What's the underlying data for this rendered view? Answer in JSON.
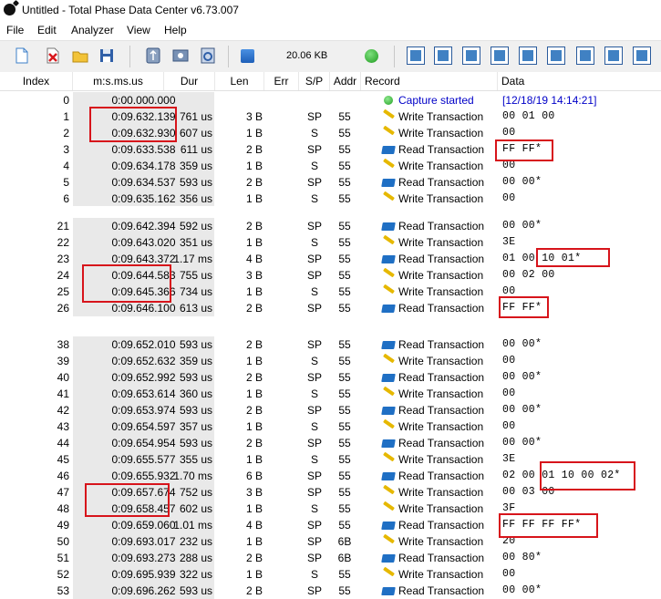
{
  "window": {
    "title": "Untitled - Total Phase Data Center v6.73.007"
  },
  "menu": [
    "File",
    "Edit",
    "Analyzer",
    "View",
    "Help"
  ],
  "toolbar": {
    "file_size": "20.06 KB"
  },
  "columns": [
    "Index",
    "m:s.ms.us",
    "Dur",
    "Len",
    "Err",
    "S/P",
    "Addr",
    "Record",
    "Data"
  ],
  "rows": [
    {
      "index": "0",
      "time": "0:00.000.000",
      "dur": "",
      "len": "",
      "sp": "",
      "addr": "",
      "record": "Capture started",
      "type": "start",
      "data": "[12/18/19 14:14:21]"
    },
    {
      "index": "1",
      "time": "0:09.632.139",
      "dur": "761 us",
      "len": "3 B",
      "sp": "SP",
      "addr": "55",
      "record": "Write Transaction",
      "type": "write",
      "data": "00 01 00"
    },
    {
      "index": "2",
      "time": "0:09.632.930",
      "dur": "607 us",
      "len": "1 B",
      "sp": "S",
      "addr": "55",
      "record": "Write Transaction",
      "type": "write",
      "data": "00"
    },
    {
      "index": "3",
      "time": "0:09.633.538",
      "dur": "611 us",
      "len": "2 B",
      "sp": "SP",
      "addr": "55",
      "record": "Read Transaction",
      "type": "read",
      "data": "FF FF*"
    },
    {
      "index": "4",
      "time": "0:09.634.178",
      "dur": "359 us",
      "len": "1 B",
      "sp": "S",
      "addr": "55",
      "record": "Write Transaction",
      "type": "write",
      "data": "00"
    },
    {
      "index": "5",
      "time": "0:09.634.537",
      "dur": "593 us",
      "len": "2 B",
      "sp": "SP",
      "addr": "55",
      "record": "Read Transaction",
      "type": "read",
      "data": "00 00*"
    },
    {
      "index": "6",
      "time": "0:09.635.162",
      "dur": "356 us",
      "len": "1 B",
      "sp": "S",
      "addr": "55",
      "record": "Write Transaction",
      "type": "write",
      "data": "00"
    },
    {
      "index": "21",
      "time": "0:09.642.394",
      "dur": "592 us",
      "len": "2 B",
      "sp": "SP",
      "addr": "55",
      "record": "Read Transaction",
      "type": "read",
      "data": "00 00*"
    },
    {
      "index": "22",
      "time": "0:09.643.020",
      "dur": "351 us",
      "len": "1 B",
      "sp": "S",
      "addr": "55",
      "record": "Write Transaction",
      "type": "write",
      "data": "3E"
    },
    {
      "index": "23",
      "time": "0:09.643.372",
      "dur": "1.17 ms",
      "len": "4 B",
      "sp": "SP",
      "addr": "55",
      "record": "Read Transaction",
      "type": "read",
      "data": "01 00 10 01*"
    },
    {
      "index": "24",
      "time": "0:09.644.583",
      "dur": "755 us",
      "len": "3 B",
      "sp": "SP",
      "addr": "55",
      "record": "Write Transaction",
      "type": "write",
      "data": "00 02 00"
    },
    {
      "index": "25",
      "time": "0:09.645.366",
      "dur": "734 us",
      "len": "1 B",
      "sp": "S",
      "addr": "55",
      "record": "Write Transaction",
      "type": "write",
      "data": "00"
    },
    {
      "index": "26",
      "time": "0:09.646.100",
      "dur": "613 us",
      "len": "2 B",
      "sp": "SP",
      "addr": "55",
      "record": "Read Transaction",
      "type": "read",
      "data": "FF FF*"
    },
    {
      "index": "38",
      "time": "0:09.652.010",
      "dur": "593 us",
      "len": "2 B",
      "sp": "SP",
      "addr": "55",
      "record": "Read Transaction",
      "type": "read",
      "data": "00 00*"
    },
    {
      "index": "39",
      "time": "0:09.652.632",
      "dur": "359 us",
      "len": "1 B",
      "sp": "S",
      "addr": "55",
      "record": "Write Transaction",
      "type": "write",
      "data": "00"
    },
    {
      "index": "40",
      "time": "0:09.652.992",
      "dur": "593 us",
      "len": "2 B",
      "sp": "SP",
      "addr": "55",
      "record": "Read Transaction",
      "type": "read",
      "data": "00 00*"
    },
    {
      "index": "41",
      "time": "0:09.653.614",
      "dur": "360 us",
      "len": "1 B",
      "sp": "S",
      "addr": "55",
      "record": "Write Transaction",
      "type": "write",
      "data": "00"
    },
    {
      "index": "42",
      "time": "0:09.653.974",
      "dur": "593 us",
      "len": "2 B",
      "sp": "SP",
      "addr": "55",
      "record": "Read Transaction",
      "type": "read",
      "data": "00 00*"
    },
    {
      "index": "43",
      "time": "0:09.654.597",
      "dur": "357 us",
      "len": "1 B",
      "sp": "S",
      "addr": "55",
      "record": "Write Transaction",
      "type": "write",
      "data": "00"
    },
    {
      "index": "44",
      "time": "0:09.654.954",
      "dur": "593 us",
      "len": "2 B",
      "sp": "SP",
      "addr": "55",
      "record": "Read Transaction",
      "type": "read",
      "data": "00 00*"
    },
    {
      "index": "45",
      "time": "0:09.655.577",
      "dur": "355 us",
      "len": "1 B",
      "sp": "S",
      "addr": "55",
      "record": "Write Transaction",
      "type": "write",
      "data": "3E"
    },
    {
      "index": "46",
      "time": "0:09.655.932",
      "dur": "1.70 ms",
      "len": "6 B",
      "sp": "SP",
      "addr": "55",
      "record": "Read Transaction",
      "type": "read",
      "data": "02 00 01 10 00 02*"
    },
    {
      "index": "47",
      "time": "0:09.657.674",
      "dur": "752 us",
      "len": "3 B",
      "sp": "SP",
      "addr": "55",
      "record": "Write Transaction",
      "type": "write",
      "data": "00 03 00"
    },
    {
      "index": "48",
      "time": "0:09.658.457",
      "dur": "602 us",
      "len": "1 B",
      "sp": "S",
      "addr": "55",
      "record": "Write Transaction",
      "type": "write",
      "data": "3F"
    },
    {
      "index": "49",
      "time": "0:09.659.060",
      "dur": "1.01 ms",
      "len": "4 B",
      "sp": "SP",
      "addr": "55",
      "record": "Read Transaction",
      "type": "read",
      "data": "FF FF FF FF*"
    },
    {
      "index": "50",
      "time": "0:09.693.017",
      "dur": "232 us",
      "len": "1 B",
      "sp": "SP",
      "addr": "6B",
      "record": "Write Transaction",
      "type": "write",
      "data": "20"
    },
    {
      "index": "51",
      "time": "0:09.693.273",
      "dur": "288 us",
      "len": "2 B",
      "sp": "SP",
      "addr": "6B",
      "record": "Read Transaction",
      "type": "read",
      "data": "00 80*"
    },
    {
      "index": "52",
      "time": "0:09.695.939",
      "dur": "322 us",
      "len": "1 B",
      "sp": "S",
      "addr": "55",
      "record": "Write Transaction",
      "type": "write",
      "data": "00"
    },
    {
      "index": "53",
      "time": "0:09.696.262",
      "dur": "593 us",
      "len": "2 B",
      "sp": "SP",
      "addr": "55",
      "record": "Read Transaction",
      "type": "read",
      "data": "00 00*"
    }
  ],
  "colors": {
    "highlight": "#d7141b",
    "time_column_bg": "#e9e9e9",
    "start_text": "#0000c8"
  }
}
